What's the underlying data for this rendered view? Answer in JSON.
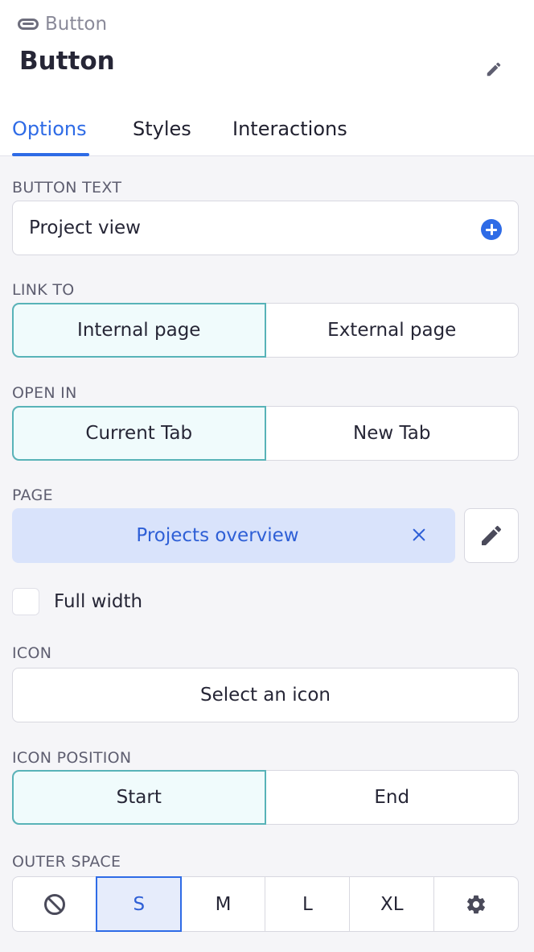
{
  "header": {
    "breadcrumb": "Button",
    "title": "Button"
  },
  "tabs": [
    {
      "label": "Options",
      "active": true
    },
    {
      "label": "Styles",
      "active": false
    },
    {
      "label": "Interactions",
      "active": false
    }
  ],
  "button_text": {
    "label": "BUTTON TEXT",
    "value": "Project view"
  },
  "link_to": {
    "label": "LINK TO",
    "options": [
      "Internal page",
      "External page"
    ],
    "selected": "Internal page"
  },
  "open_in": {
    "label": "OPEN IN",
    "options": [
      "Current Tab",
      "New Tab"
    ],
    "selected": "Current Tab"
  },
  "page": {
    "label": "PAGE",
    "value": "Projects overview"
  },
  "full_width": {
    "label": "Full width",
    "checked": false
  },
  "icon": {
    "label": "ICON",
    "placeholder": "Select an icon"
  },
  "icon_position": {
    "label": "ICON POSITION",
    "options": [
      "Start",
      "End"
    ],
    "selected": "Start"
  },
  "outer_space": {
    "label": "OUTER SPACE",
    "options": [
      "S",
      "M",
      "L",
      "XL"
    ],
    "selected": "S"
  },
  "colors": {
    "accent": "#2e6be6",
    "selected_teal": "#58b3b8",
    "page_chip_bg": "#d9e3fb"
  }
}
